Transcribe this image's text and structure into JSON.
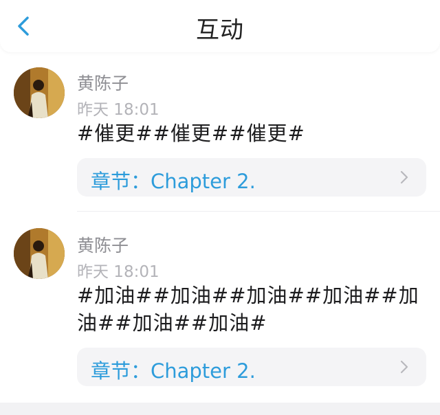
{
  "header": {
    "title": "互动",
    "back_icon": "chevron-left-icon",
    "accent_color": "#2d9cdb"
  },
  "comments": [
    {
      "author": "黄陈子",
      "time": "昨天 18:01",
      "text": "#催更##催更##催更#",
      "chapter_label": "章节：Chapter 2.",
      "chapter_icon": "chevron-right-icon"
    },
    {
      "author": "黄陈子",
      "time": "昨天 18:01",
      "text": "#加油##加油##加油##加油##加油##加油##加油#",
      "chapter_label": "章节：Chapter 2.",
      "chapter_icon": "chevron-right-icon"
    }
  ]
}
